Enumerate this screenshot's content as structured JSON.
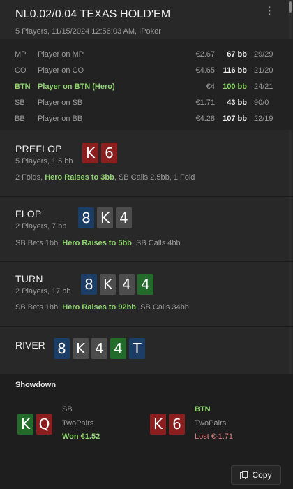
{
  "header": {
    "title": "NL0.02/0.04 TEXAS HOLD'EM",
    "subtitle": "5 Players, 11/15/2024 12:56:03 AM, IPoker"
  },
  "players": [
    {
      "pos": "MP",
      "name": "Player on MP",
      "stack": "€2.67",
      "bb": "67 bb",
      "stats": "29/29",
      "hero": false
    },
    {
      "pos": "CO",
      "name": "Player on CO",
      "stack": "€4.65",
      "bb": "116 bb",
      "stats": "21/20",
      "hero": false
    },
    {
      "pos": "BTN",
      "name": "Player on BTN (Hero)",
      "stack": "€4",
      "bb": "100 bb",
      "stats": "24/21",
      "hero": true
    },
    {
      "pos": "SB",
      "name": "Player on SB",
      "stack": "€1.71",
      "bb": "43 bb",
      "stats": "90/0",
      "hero": false
    },
    {
      "pos": "BB",
      "name": "Player on BB",
      "stack": "€4.28",
      "bb": "107 bb",
      "stats": "22/19",
      "hero": false
    }
  ],
  "preflop": {
    "name": "PREFLOP",
    "sub": "5 Players, 1.5 bb",
    "cards": [
      {
        "rank": "K",
        "suit": "h"
      },
      {
        "rank": "6",
        "suit": "h"
      }
    ],
    "actions": {
      "pre": "2 Folds, ",
      "hero": "Hero Raises to 3bb",
      "post": ", SB Calls 2.5bb, 1 Fold"
    }
  },
  "flop": {
    "name": "FLOP",
    "sub": "2 Players, 7 bb",
    "cards": [
      {
        "rank": "8",
        "suit": "d"
      },
      {
        "rank": "K",
        "suit": "s"
      },
      {
        "rank": "4",
        "suit": "s"
      }
    ],
    "actions": {
      "pre": "SB Bets 1bb, ",
      "hero": "Hero Raises to 5bb",
      "post": ", SB Calls 4bb"
    }
  },
  "turn": {
    "name": "TURN",
    "sub": "2 Players, 17 bb",
    "cards": [
      {
        "rank": "8",
        "suit": "d"
      },
      {
        "rank": "K",
        "suit": "s"
      },
      {
        "rank": "4",
        "suit": "s"
      },
      {
        "rank": "4",
        "suit": "c"
      }
    ],
    "actions": {
      "pre": "SB Bets 1bb, ",
      "hero": "Hero Raises to 92bb",
      "post": ", SB Calls 34bb"
    }
  },
  "river": {
    "name": "RIVER",
    "cards": [
      {
        "rank": "8",
        "suit": "d"
      },
      {
        "rank": "K",
        "suit": "s"
      },
      {
        "rank": "4",
        "suit": "s"
      },
      {
        "rank": "4",
        "suit": "c"
      },
      {
        "rank": "T",
        "suit": "d"
      }
    ]
  },
  "showdown": {
    "title": "Showdown",
    "left": {
      "cards": [
        {
          "rank": "K",
          "suit": "c"
        },
        {
          "rank": "Q",
          "suit": "h"
        }
      ],
      "pos": "SB",
      "hand": "TwoPairs",
      "result": "Won €1.52"
    },
    "right": {
      "cards": [
        {
          "rank": "K",
          "suit": "h"
        },
        {
          "rank": "6",
          "suit": "h"
        }
      ],
      "pos": "BTN",
      "hand": "TwoPairs",
      "result": "Lost €-1.71"
    },
    "copy_label": "Copy"
  },
  "colors": {
    "background": "#282828",
    "hero_green": "#8fd46f",
    "loss_red": "#e07b7b",
    "suit_hearts": "#8b1f1f",
    "suit_spades": "#4d4d4d",
    "suit_diamonds": "#1c3d66",
    "suit_clubs": "#236b2a"
  },
  "icons": {
    "menu": "kebab-menu-icon",
    "copy": "copy-icon"
  }
}
